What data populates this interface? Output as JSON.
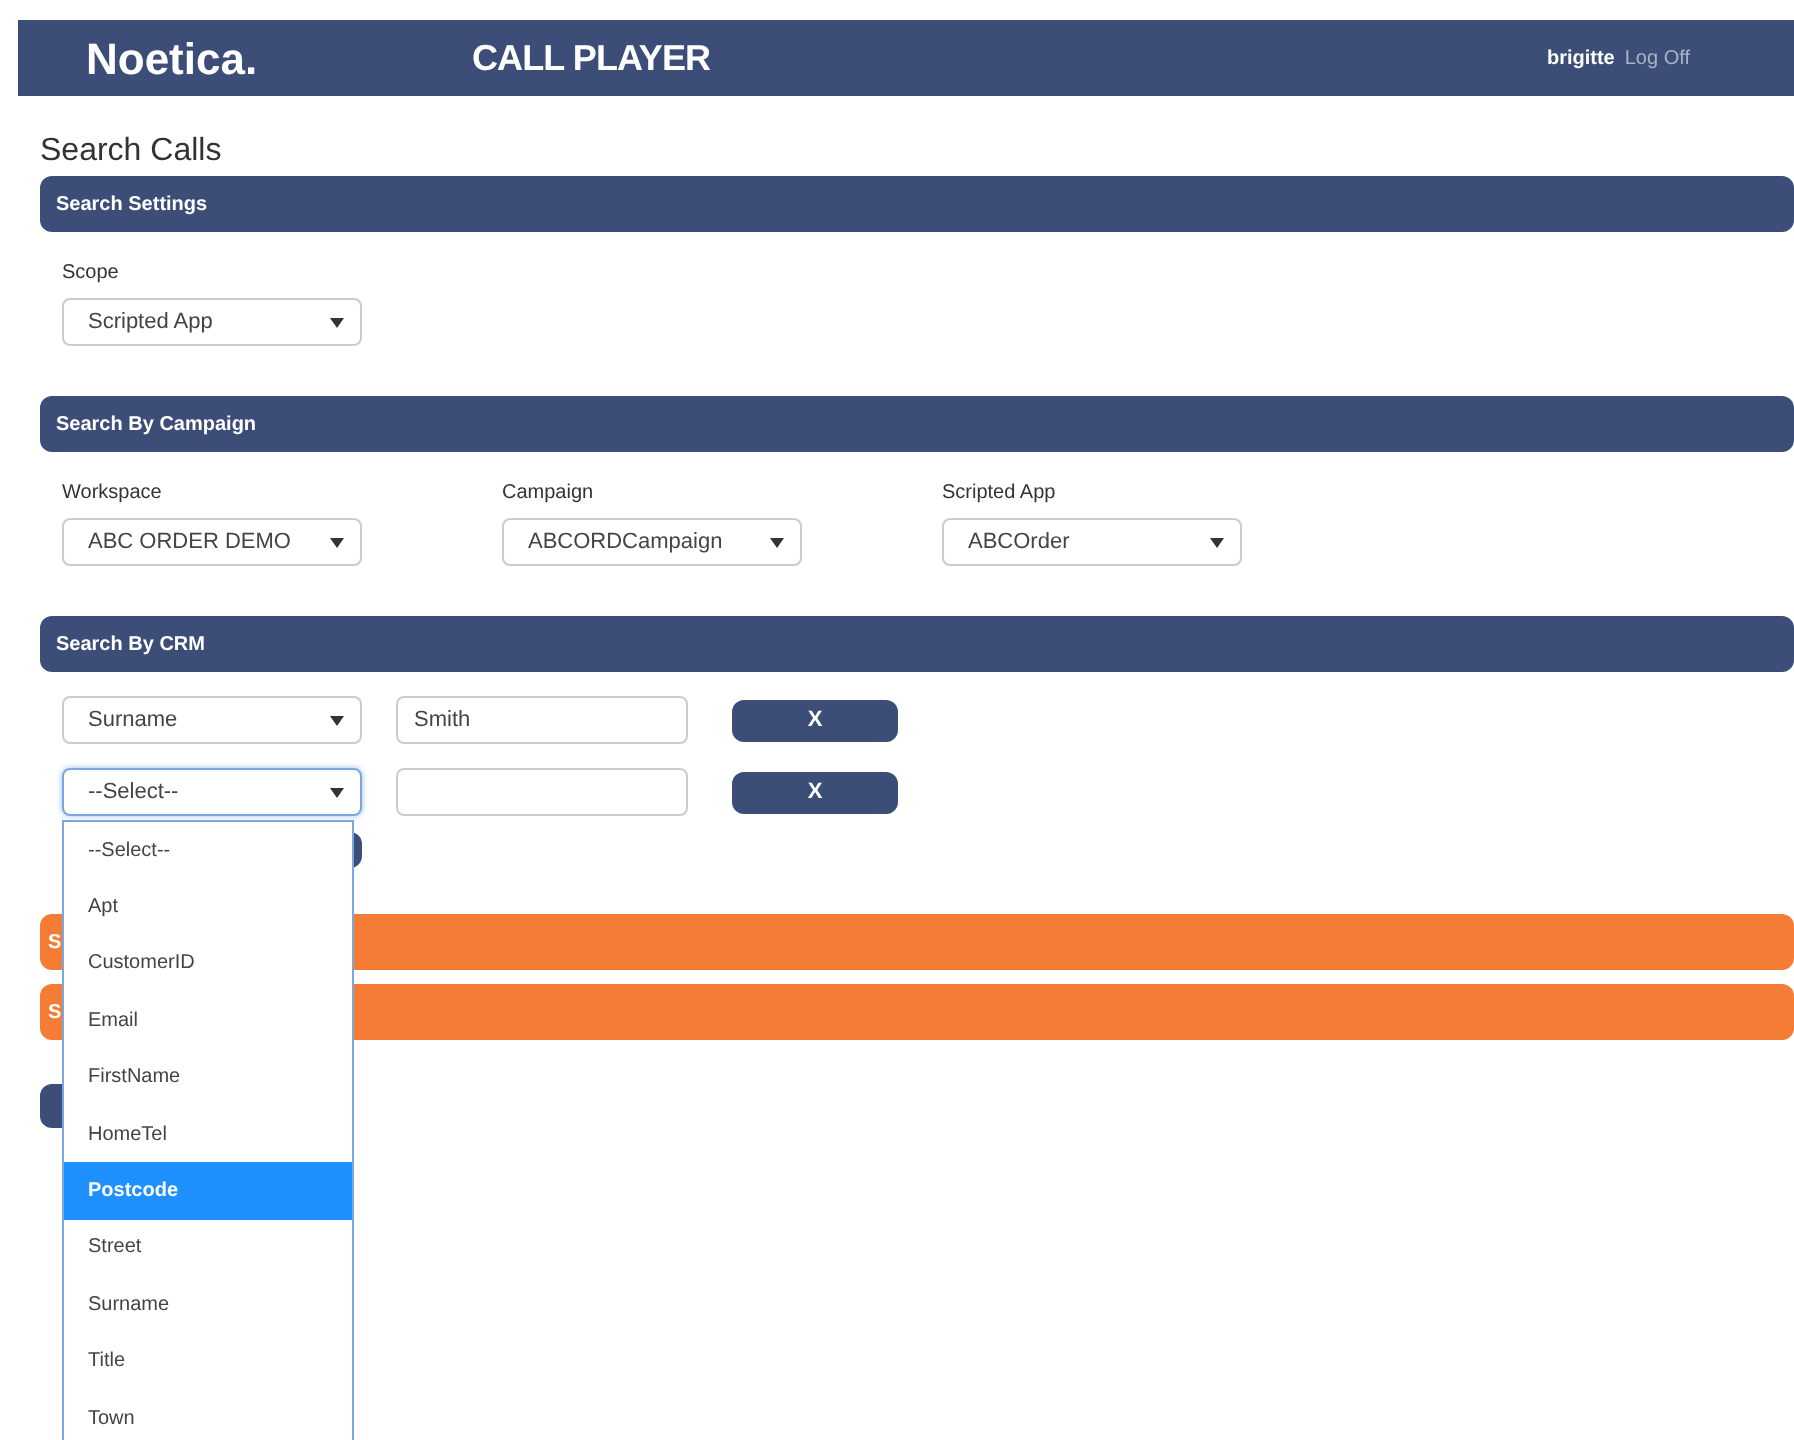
{
  "header": {
    "logo": "Noetica.",
    "app_title": "CALL PLAYER",
    "user": "brigitte",
    "logoff": "Log Off"
  },
  "page_title": "Search Calls",
  "search_settings": {
    "title": "Search Settings",
    "scope": {
      "label": "Scope",
      "value": "Scripted App"
    }
  },
  "search_by_campaign": {
    "title": "Search By Campaign",
    "fields": [
      {
        "label": "Workspace",
        "value": "ABC ORDER DEMO"
      },
      {
        "label": "Campaign",
        "value": "ABCORDCampaign"
      },
      {
        "label": "Scripted App",
        "value": "ABCOrder"
      }
    ]
  },
  "search_by_crm": {
    "title": "Search By CRM",
    "rows": [
      {
        "field": "Surname",
        "value": "Smith",
        "remove": "X",
        "focused": false
      },
      {
        "field": "--Select--",
        "value": "",
        "remove": "X",
        "focused": true
      }
    ]
  },
  "orange_sections": [
    {
      "title": "S"
    },
    {
      "title": "S"
    }
  ],
  "dropdown": {
    "options": [
      {
        "label": "--Select--",
        "selected": false
      },
      {
        "label": "Apt",
        "selected": false
      },
      {
        "label": "CustomerID",
        "selected": false
      },
      {
        "label": "Email",
        "selected": false
      },
      {
        "label": "FirstName",
        "selected": false
      },
      {
        "label": "HomeTel",
        "selected": false
      },
      {
        "label": "Postcode",
        "selected": true
      },
      {
        "label": "Street",
        "selected": false
      },
      {
        "label": "Surname",
        "selected": false
      },
      {
        "label": "Title",
        "selected": false
      },
      {
        "label": "Town",
        "selected": false
      }
    ]
  }
}
